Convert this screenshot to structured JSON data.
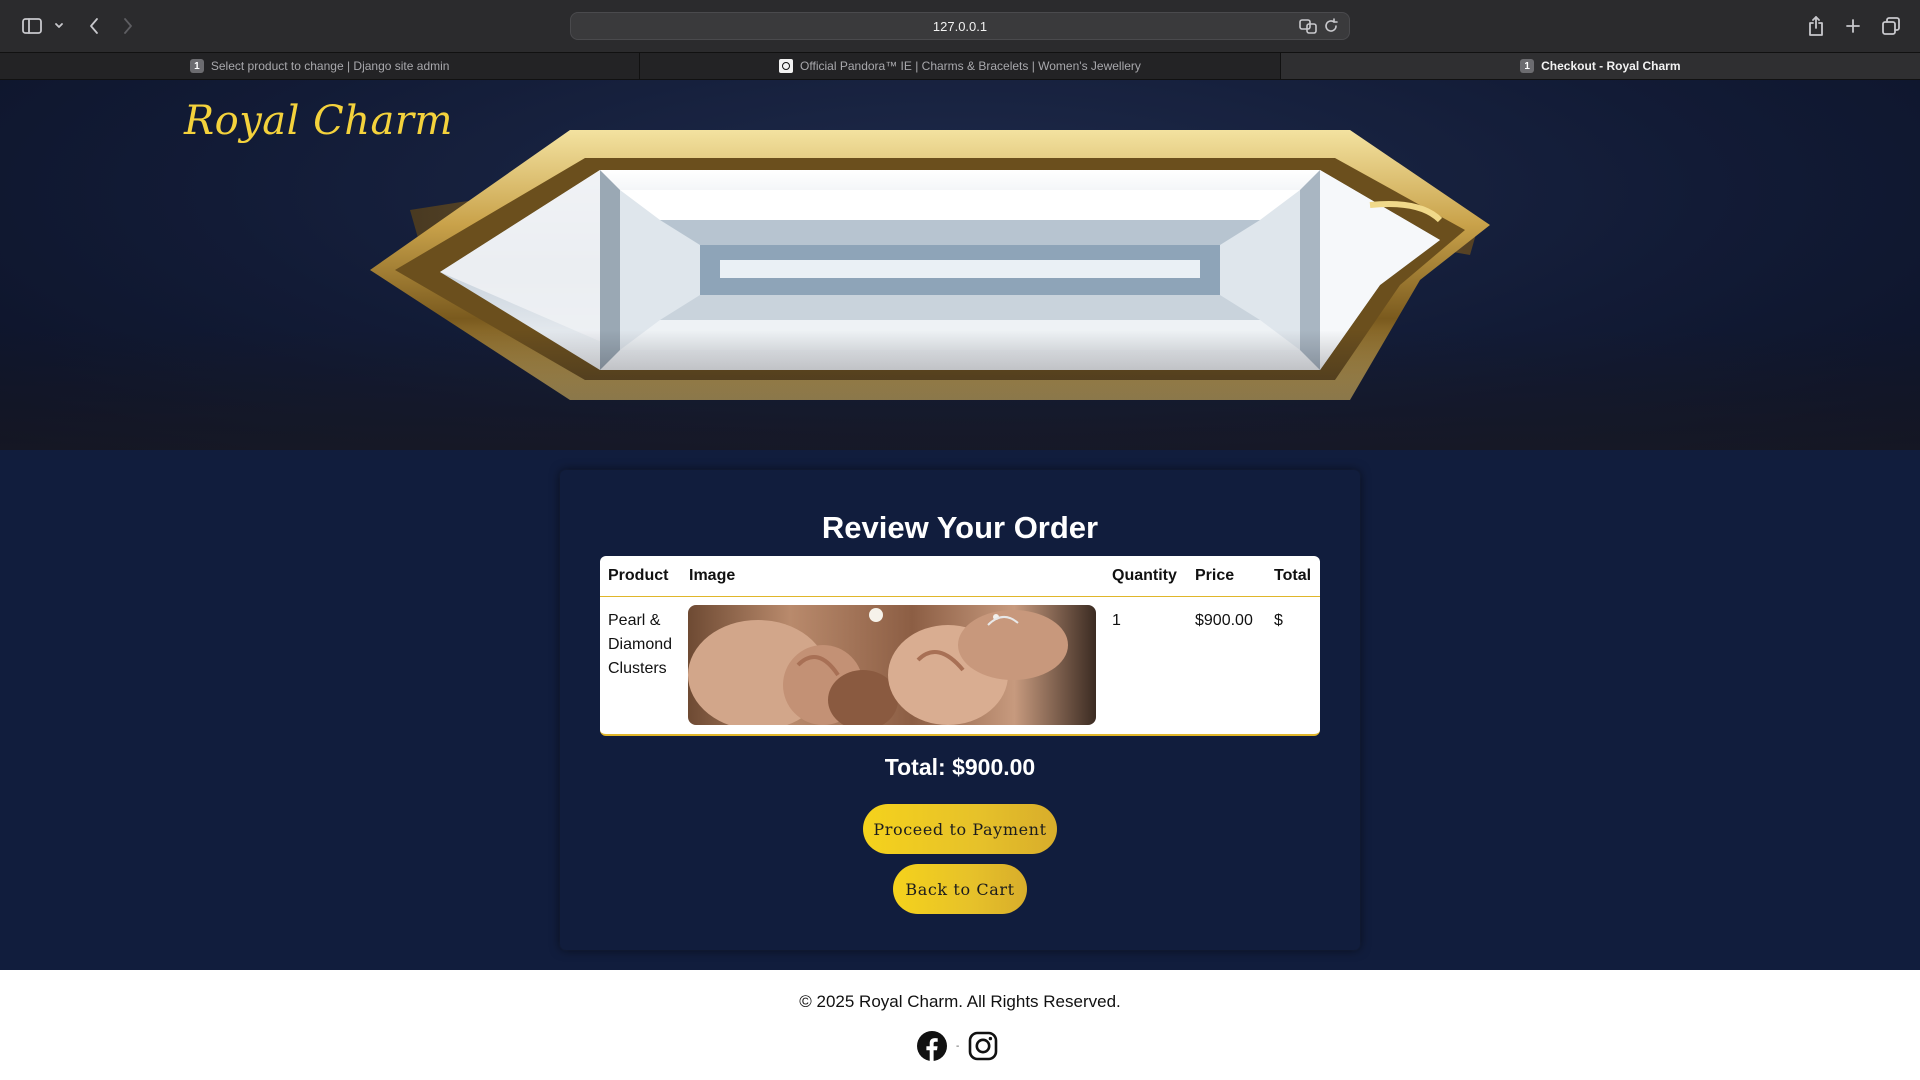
{
  "browser": {
    "url": "127.0.0.1",
    "tabs": [
      {
        "label": "Select product to change | Django site admin",
        "favicon": "1",
        "active": false
      },
      {
        "label": "Official Pandora™ IE | Charms & Bracelets | Women's Jewellery",
        "favicon": "pandora-icon",
        "active": false
      },
      {
        "label": "Checkout - Royal Charm",
        "favicon": "1",
        "active": true
      }
    ]
  },
  "site": {
    "brand": "Royal Charm",
    "hero_image": "diamond-ring-banner"
  },
  "order": {
    "title": "Review Your Order",
    "columns": [
      "Product",
      "Image",
      "Quantity",
      "Price",
      "Total"
    ],
    "items": [
      {
        "product_line1": "Pearl &",
        "product_line2": "Diamond",
        "product_line3": "Clusters",
        "image": "pearl-earrings-hands-photo",
        "quantity": "1",
        "price": "$900.00",
        "total": "$"
      }
    ],
    "total": "Total: $900.00",
    "proceed_label": "Proceed to Payment",
    "back_label": "Back to Cart"
  },
  "footer": {
    "copyright": "© 2025 Royal Charm. All Rights Reserved.",
    "social_separator": "-",
    "socials": [
      "facebook-icon",
      "instagram-icon"
    ]
  },
  "colors": {
    "brand_gold": "#f4d23c",
    "page_navy": "#111d3d",
    "button_gold": "#f5d21c",
    "browser_chrome": "#2b2b2d"
  }
}
